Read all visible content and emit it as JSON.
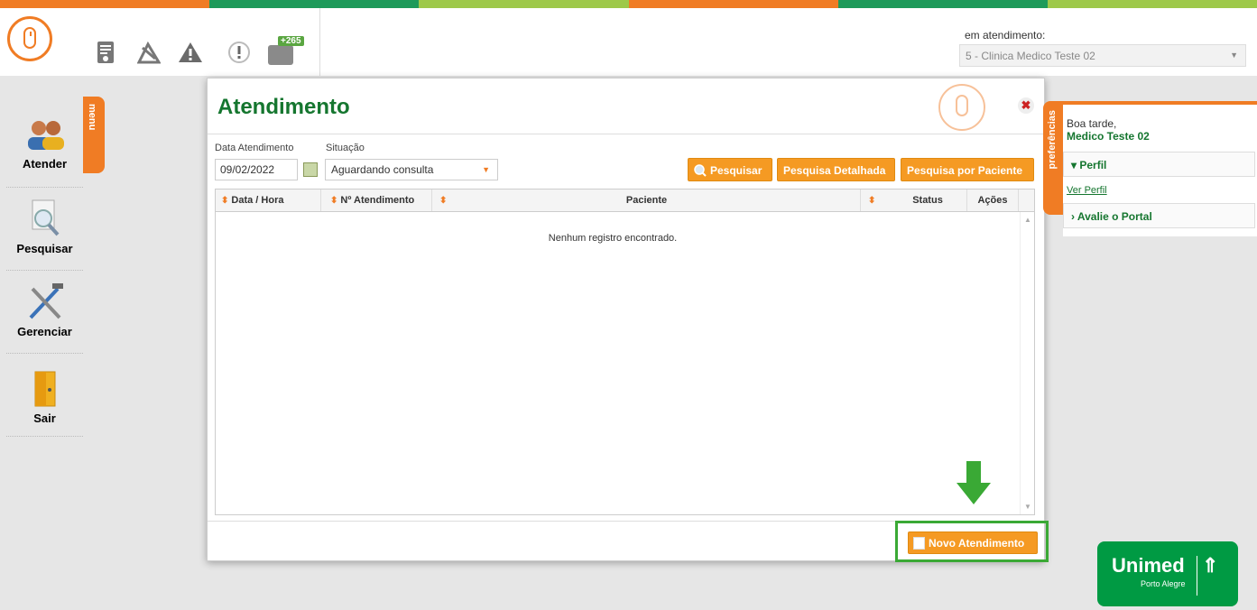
{
  "colors": {
    "orange": "#f07c24",
    "green_dark": "#15762f",
    "green_bright": "#1e9a5a",
    "lime": "#9ec94a",
    "button_orange": "#f59a23",
    "highlight_green": "#3aa935",
    "unimed_green": "#009a43"
  },
  "header": {
    "icons": [
      "mouse-logo-icon",
      "document-icon",
      "tools-icon",
      "warning-icon",
      "alert-bubble-icon",
      "notifications-icon"
    ],
    "notification_badge": "+265",
    "em_atendimento_label": "em atendimento:",
    "em_atendimento_value": "5 - Clinica Medico Teste 02"
  },
  "sidebar": {
    "menu_tab": "menu",
    "items": [
      {
        "label": "Atender",
        "icon": "users-icon"
      },
      {
        "label": "Pesquisar",
        "icon": "search-document-icon"
      },
      {
        "label": "Gerenciar",
        "icon": "wrench-hammer-icon"
      },
      {
        "label": "Sair",
        "icon": "door-exit-icon"
      }
    ]
  },
  "dialog": {
    "title": "Atendimento",
    "date_label": "Data Atendimento",
    "date_value": "09/02/2022",
    "situacao_label": "Situação",
    "situacao_value": "Aguardando consulta",
    "buttons": {
      "pesquisar": "Pesquisar",
      "pesquisa_detalhada": "Pesquisa Detalhada",
      "pesquisa_paciente": "Pesquisa por Paciente",
      "novo_atendimento": "Novo Atendimento"
    },
    "columns": [
      "Data / Hora",
      "Nº Atendimento",
      "Paciente",
      "Status",
      "Ações"
    ],
    "empty_message": "Nenhum registro encontrado."
  },
  "preferences": {
    "tab_label": "preferências",
    "greeting": "Boa tarde,",
    "user_name": "Medico Teste 02",
    "perfil": "Perfil",
    "ver_perfil": "Ver Perfil",
    "avalie": "Avalie o Portal"
  },
  "brand": {
    "name": "Unimed",
    "city": "Porto Alegre"
  }
}
